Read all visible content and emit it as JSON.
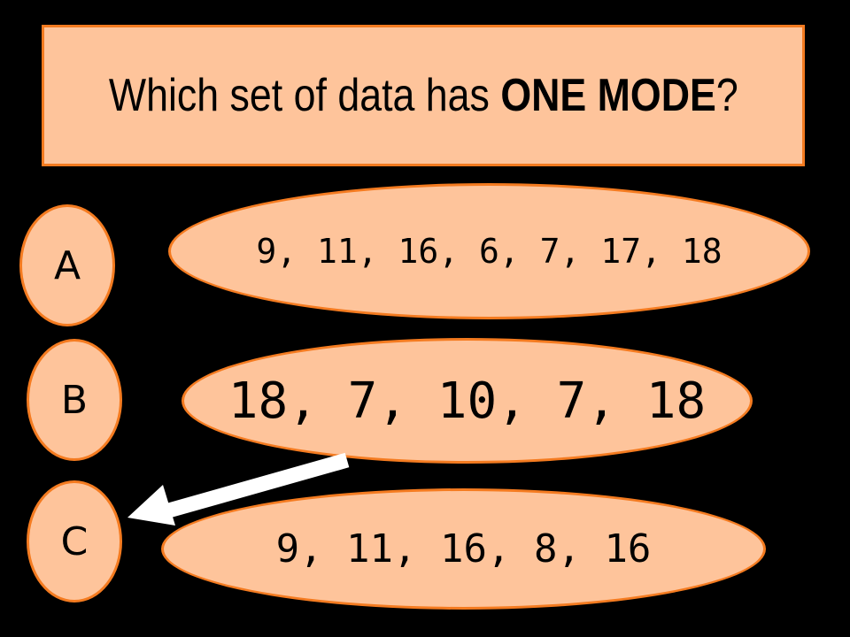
{
  "question": {
    "prefix": "Which set of data has ",
    "emphasis": "ONE MODE",
    "suffix": "?"
  },
  "options": [
    {
      "letter": "A",
      "data": "9, 11, 16, 6, 7, 17, 18"
    },
    {
      "letter": "B",
      "data": "18, 7, 10, 7, 18"
    },
    {
      "letter": "C",
      "data": "9, 11, 16, 8, 16"
    }
  ],
  "colors": {
    "background": "#000000",
    "fill": "#fec49b",
    "border": "#f47b20",
    "arrow": "#ffffff"
  },
  "arrow": {
    "icon": "arrow-pointer-icon",
    "points_to": "C"
  }
}
